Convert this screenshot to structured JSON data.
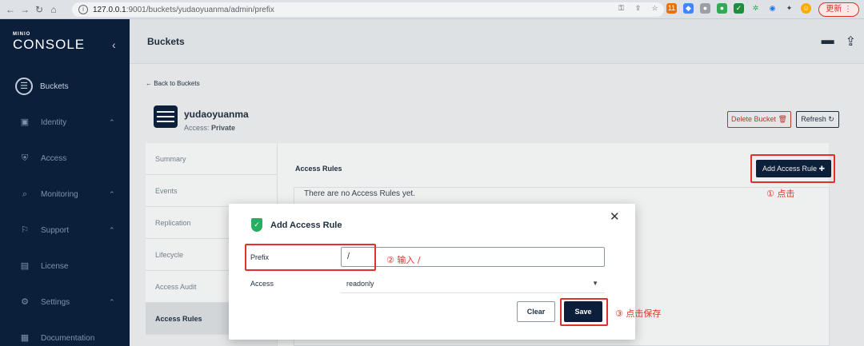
{
  "browser": {
    "url_host": "127.0.0.1",
    "url_path": ":9001/buckets/yudaoyuanma/admin/prefix",
    "update_label": "更新 ⋮",
    "ext_badge": "11"
  },
  "sidebar": {
    "logo_top": "MINIO",
    "logo_bottom": "CONSOLE",
    "items": [
      {
        "label": "Buckets",
        "icon": "bucket-icon"
      },
      {
        "label": "Identity",
        "icon": "identity-icon"
      },
      {
        "label": "Access",
        "icon": "lock-icon"
      },
      {
        "label": "Monitoring",
        "icon": "magnifier-icon"
      },
      {
        "label": "Support",
        "icon": "support-icon"
      },
      {
        "label": "License",
        "icon": "license-icon"
      },
      {
        "label": "Settings",
        "icon": "gear-icon"
      },
      {
        "label": "Documentation",
        "icon": "docs-icon"
      }
    ]
  },
  "header": {
    "title": "Buckets"
  },
  "bucket": {
    "back_label": "← Back to Buckets",
    "name": "yudaoyuanma",
    "access_prefix": "Access: ",
    "access_value": "Private",
    "delete_label": "Delete Bucket 🗑",
    "refresh_label": "Refresh ↻"
  },
  "tabs": [
    "Summary",
    "Events",
    "Replication",
    "Lifecycle",
    "Access Audit",
    "Access Rules"
  ],
  "content": {
    "title": "Access Rules",
    "add_rule_label": "Add Access Rule ✚",
    "empty_text": "There are no Access Rules yet."
  },
  "modal": {
    "title": "Add Access Rule",
    "prefix_label": "Prefix",
    "prefix_value": "/",
    "access_label": "Access",
    "access_value": "readonly",
    "clear_label": "Clear",
    "save_label": "Save"
  },
  "annotations": {
    "step1": "① 点击",
    "step2": "② 输入 /",
    "step3": "③ 点击保存"
  },
  "colors": {
    "sidebar_bg": "#0b1f3a",
    "primary": "#0b1f3a",
    "danger": "#c0392b",
    "annotation": "#e0322b",
    "shield": "#27ae60"
  }
}
